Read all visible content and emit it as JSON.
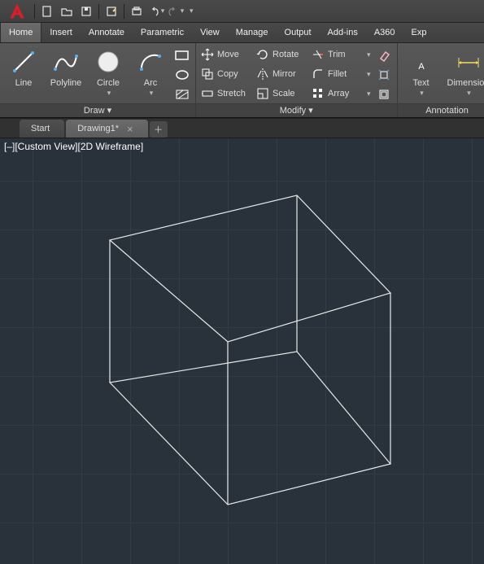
{
  "menu": {
    "items": [
      "Home",
      "Insert",
      "Annotate",
      "Parametric",
      "View",
      "Manage",
      "Output",
      "Add-ins",
      "A360",
      "Exp"
    ],
    "activeIndex": 0
  },
  "panels": {
    "draw": {
      "title": "Draw ▾",
      "line": "Line",
      "polyline": "Polyline",
      "circle": "Circle",
      "arc": "Arc"
    },
    "modify": {
      "title": "Modify ▾",
      "move": "Move",
      "copy": "Copy",
      "stretch": "Stretch",
      "rotate": "Rotate",
      "mirror": "Mirror",
      "scale": "Scale",
      "trim": "Trim",
      "fillet": "Fillet",
      "array": "Array"
    },
    "annotation": {
      "title": "Annotation",
      "text": "Text",
      "dimension": "Dimension"
    }
  },
  "tabs": {
    "start": "Start",
    "drawing": "Drawing1*"
  },
  "status_caption": "[–][Custom View][2D Wireframe]"
}
